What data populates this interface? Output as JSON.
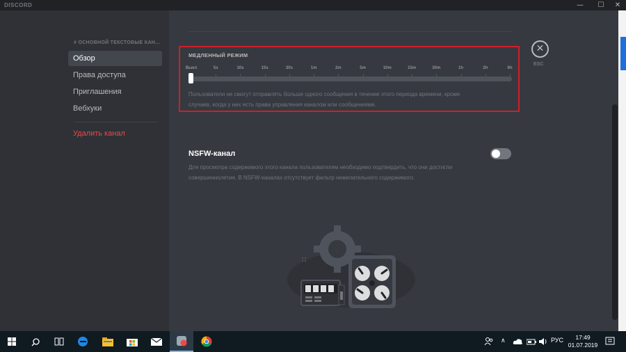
{
  "window": {
    "brand": "DISCORD",
    "minimize": "—",
    "maximize": "☐",
    "close": "✕"
  },
  "sidebar": {
    "section_header": "# ОСНОВНОЙ ТЕКСТОВЫЕ КАН...",
    "items": [
      {
        "label": "Обзор",
        "active": true
      },
      {
        "label": "Права доступа"
      },
      {
        "label": "Приглашения"
      },
      {
        "label": "Вебхуки"
      }
    ],
    "delete_label": "Удалить канал"
  },
  "slowmode": {
    "title": "МЕДЛЕННЫЙ РЕЖИМ",
    "ticks": [
      "Выкл",
      "5s",
      "10s",
      "15s",
      "30s",
      "1m",
      "2m",
      "5m",
      "10m",
      "15m",
      "30m",
      "1h",
      "2h",
      "6h"
    ],
    "selected": "Выкл",
    "description_line1": "Пользователи не смогут отправлять больше одного сообщения в течение этого периода времени, кроме",
    "description_line2": "случаев, когда у них есть права управления каналом или сообщениями."
  },
  "close": {
    "icon": "close-icon",
    "label": "ESC"
  },
  "nsfw": {
    "title": "NSFW-канал",
    "enabled": false,
    "description_line1": "Для просмотра содержимого этого канала пользователям необходимо подтвердить, что они достигли",
    "description_line2": "совершеннолетия. В NSFW-каналах отсутствует фильтр нежелательного содержимого."
  },
  "colors": {
    "danger": "#f04747",
    "highlight": "#d11e2b",
    "background": "#36393f",
    "sidebar": "#2f3136"
  },
  "taskbar": {
    "icons": [
      "windows-start-icon",
      "search-icon",
      "task-view-icon",
      "edge-icon",
      "file-explorer-icon",
      "store-icon",
      "mail-icon",
      "discord-icon",
      "chrome-icon"
    ],
    "language": "РУС",
    "time": "17:49",
    "date": "01.07.2019"
  }
}
